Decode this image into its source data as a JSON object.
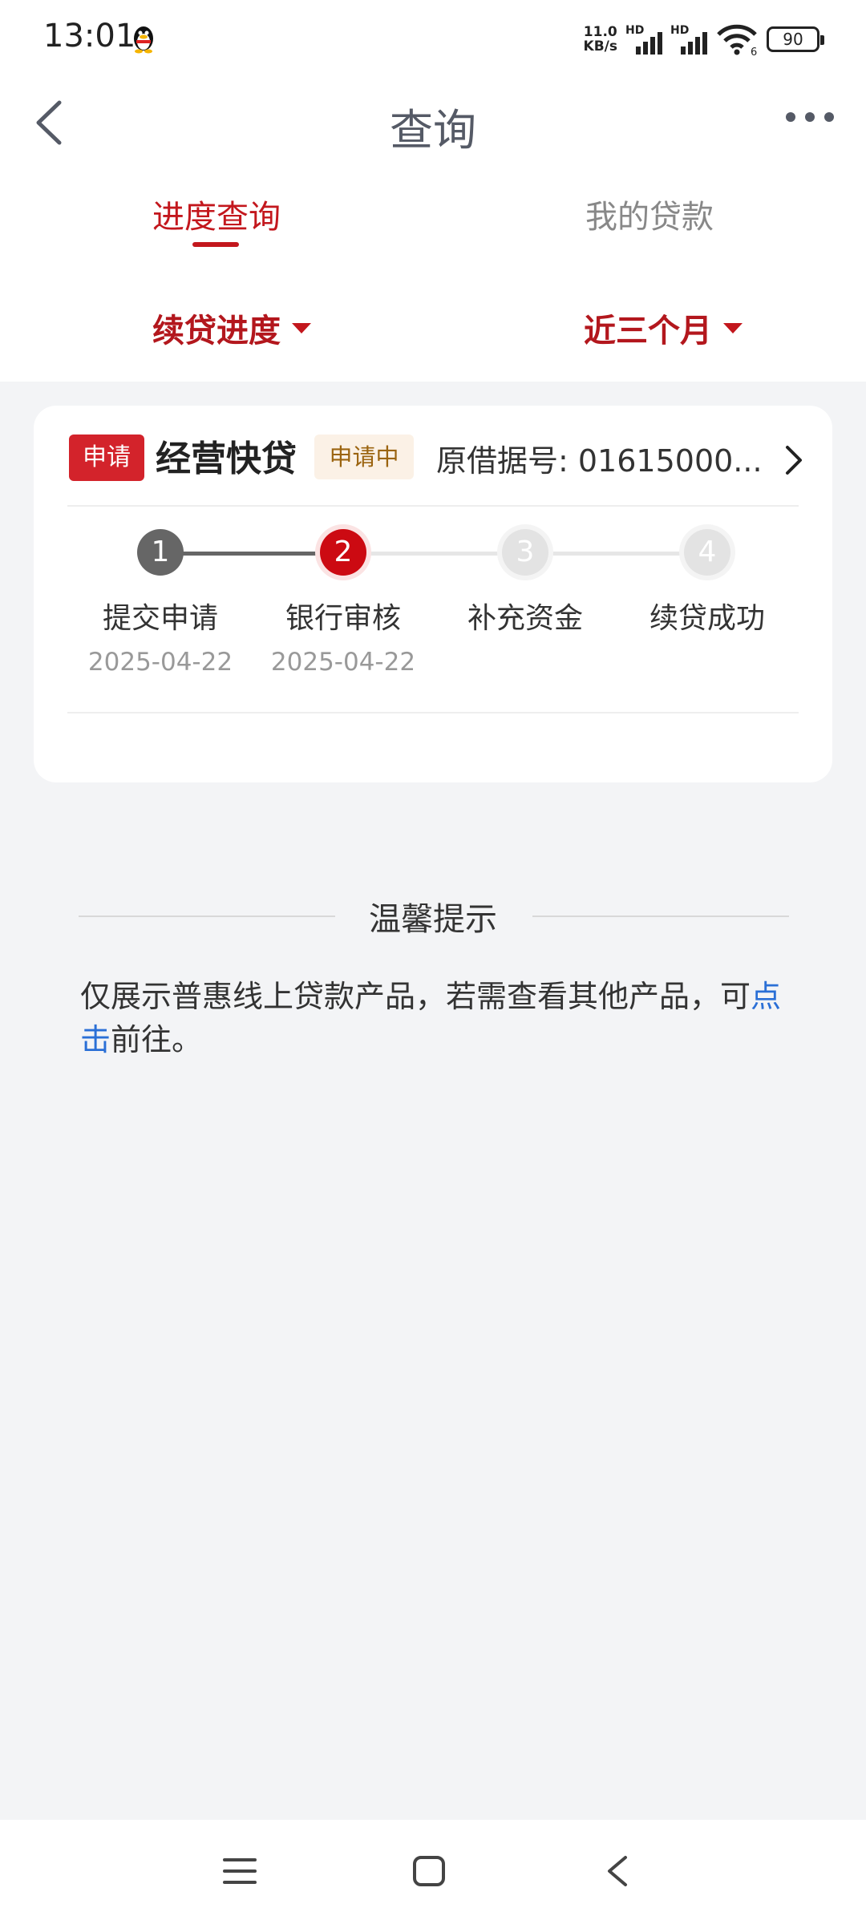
{
  "status_bar": {
    "time": "13:01",
    "net_speed_value": "11.0",
    "net_speed_unit": "KB/s",
    "hd1": "HD",
    "hd2": "HD",
    "sim2_index": "6",
    "battery": "90"
  },
  "header": {
    "title": "查询",
    "back_icon": "chevron-left-icon",
    "more_icon": "more-horizontal-icon"
  },
  "tabs": [
    {
      "label": "进度查询",
      "active": true
    },
    {
      "label": "我的贷款",
      "active": false
    }
  ],
  "filters": [
    {
      "label": "续贷进度"
    },
    {
      "label": "近三个月"
    }
  ],
  "card": {
    "type_tag": "申请",
    "product_name": "经营快贷",
    "status_tag": "申请中",
    "loan_number": "原借据号: 01615000...",
    "steps": [
      {
        "number": "1",
        "label": "提交申请",
        "date": "2025-04-22",
        "state": "done"
      },
      {
        "number": "2",
        "label": "银行审核",
        "date": "2025-04-22",
        "state": "current"
      },
      {
        "number": "3",
        "label": "补充资金",
        "date": "",
        "state": "pending"
      },
      {
        "number": "4",
        "label": "续贷成功",
        "date": "",
        "state": "pending"
      }
    ]
  },
  "tips": {
    "title": "温馨提示",
    "text_before": "仅展示普惠线上贷款产品，若需查看其他产品，可",
    "link": "点击",
    "text_after": "前往。"
  },
  "colors": {
    "accent": "#c3171d",
    "link": "#2a6fd6",
    "done_step": "#666666",
    "pending_step": "#e3e3e3"
  }
}
